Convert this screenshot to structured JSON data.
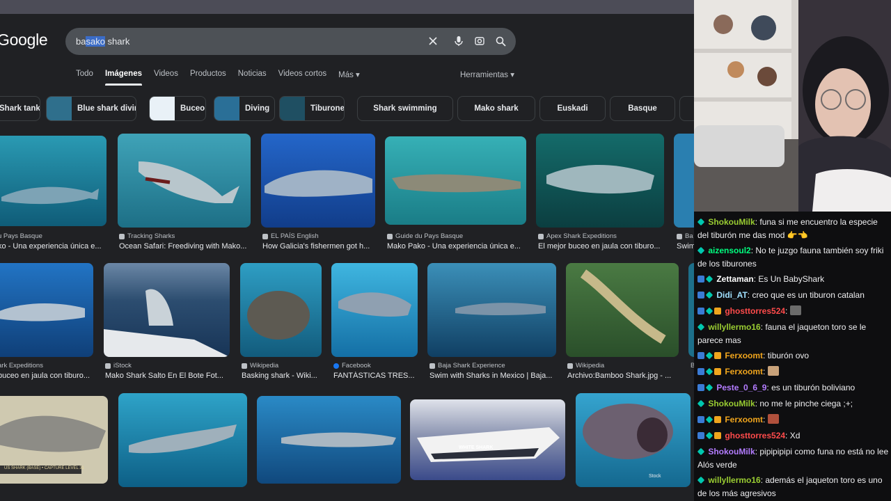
{
  "search": {
    "query_pre": "ba",
    "query_sel": "sako",
    "query_post": " shark"
  },
  "logo": "Google",
  "tabs": [
    "Todo",
    "Imágenes",
    "Videos",
    "Productos",
    "Noticias",
    "Videos cortos",
    "Más ▾"
  ],
  "tools_label": "Herramientas ▾",
  "chips": [
    {
      "label": "Shark tank",
      "thumb": ""
    },
    {
      "label": "Blue shark diving",
      "thumb": "#2f6f8c"
    },
    {
      "label": "Buceo",
      "thumb": "#e9f1f7"
    },
    {
      "label": "Diving",
      "thumb": "#2a6f97"
    },
    {
      "label": "Tiburones",
      "thumb": "#1f4f62"
    },
    {
      "label": "Shark swimming",
      "thumb": ""
    },
    {
      "label": "Mako shark",
      "thumb": ""
    },
    {
      "label": "Euskadi",
      "thumb": ""
    },
    {
      "label": "Basque",
      "thumb": ""
    }
  ],
  "results_row1": [
    {
      "source": "u Pays Basque",
      "title": "ko - Una experiencia única e...",
      "color": "#1d7a96"
    },
    {
      "source": "Tracking Sharks",
      "title": "Ocean Safari: Freediving with Mako...",
      "color": "#2e8aa1"
    },
    {
      "source": "EL PAÍS English",
      "title": "How Galicia's fishermen got h...",
      "color": "#1f5fbd"
    },
    {
      "source": "Guide du Pays Basque",
      "title": "Mako Pako - Una experiencia única e...",
      "color": "#1b8b96"
    },
    {
      "source": "Apex Shark Expeditions",
      "title": "El mejor buceo en jaula con tiburo...",
      "color": "#0f5257"
    },
    {
      "source": "Ba",
      "title": "Swim",
      "color": "#2a7fb0"
    }
  ],
  "results_row2": [
    {
      "source": "ark Expeditions",
      "title": "buceo en jaula con tiburo...",
      "color": "#1a5c9a"
    },
    {
      "source": "iStock",
      "title": "Mako Shark Salto En El Bote Fot...",
      "color": "#2d5377"
    },
    {
      "source": "Wikipedia",
      "title": "Basking shark - Wiki...",
      "color": "#1b6d8c"
    },
    {
      "source": "Facebook",
      "title": "FANTÁSTICAS TRES...",
      "color": "#1c86b8"
    },
    {
      "source": "Baja Shark Experience",
      "title": "Swim with Sharks in Mexico | Baja...",
      "color": "#1a5a84"
    },
    {
      "source": "Wikipedia",
      "title": "Archivo:Bamboo Shark.jpg - ...",
      "color": "#3d6b3a"
    },
    {
      "source": "B",
      "title": "",
      "color": "#1d6f8a"
    }
  ],
  "row3_text": {
    "caption": "US SHARK (BASE) • CAPTURE LEVEL 31",
    "boat": "WHITE SHARK",
    "stock": "Stock"
  },
  "row3_colors": [
    "#cfc9b0",
    "#1e8db0",
    "#1f6fa8",
    "#7a7fa6",
    "#2a8eb8"
  ],
  "chat": [
    {
      "badges": [
        "plus"
      ],
      "user": "ShokouMilk",
      "color": "#9acd32",
      "text": ": funa si me encuentro la especie del tiburón me das mod 👉👈"
    },
    {
      "badges": [
        "plus"
      ],
      "user": "aizensoul2",
      "color": "#00ff7f",
      "text": ": No te juzgo fauna también soy friki de los tiburones"
    },
    {
      "badges": [
        "blue",
        "plus"
      ],
      "user": "Zettaman",
      "color": "#ffffff",
      "text": ": Es Un BabyShark"
    },
    {
      "badges": [
        "blue",
        "plus"
      ],
      "user": "Didi_AT",
      "color": "#a0e0ff",
      "text": ": creo que es un tiburon catalan"
    },
    {
      "badges": [
        "blue",
        "plus",
        "gold"
      ],
      "user": "ghosttorres524",
      "color": "#ff4b4b",
      "text": ":",
      "emote": "#6b6b6b"
    },
    {
      "badges": [
        "plus"
      ],
      "user": "willyllermo16",
      "color": "#9acd32",
      "text": ": fauna el jaqueton toro se le parece mas"
    },
    {
      "badges": [
        "blue",
        "plus",
        "gold"
      ],
      "user": "Ferxoomt",
      "color": "#f0a51d",
      "text": ": tiburón ovo"
    },
    {
      "badges": [
        "blue",
        "plus",
        "gold"
      ],
      "user": "Ferxoomt",
      "color": "#f0a51d",
      "text": ":",
      "emote": "#c9a27a"
    },
    {
      "badges": [
        "blue",
        "plus"
      ],
      "user": "Peste_0_6_9",
      "color": "#b37cff",
      "text": ": es un tiburón boliviano"
    },
    {
      "badges": [
        "plus"
      ],
      "user": "ShokouMilk",
      "color": "#9acd32",
      "text": ": no me le pinche ciega ;+;"
    },
    {
      "badges": [
        "blue",
        "plus",
        "gold"
      ],
      "user": "Ferxoomt",
      "color": "#f0a51d",
      "text": ":",
      "emote": "#b0503c"
    },
    {
      "badges": [
        "blue",
        "plus",
        "gold"
      ],
      "user": "ghosttorres524",
      "color": "#ff4b4b",
      "text": ": Xd"
    },
    {
      "badges": [
        "plus"
      ],
      "user": "ShokouMilk",
      "color": "#b37cff",
      "text": ": pipipipipi como funa no está no lee Alós verde"
    },
    {
      "badges": [
        "plus"
      ],
      "user": "willyllermo16",
      "color": "#9acd32",
      "text": ": además el jaqueton toro es uno de los más agresivos"
    }
  ]
}
